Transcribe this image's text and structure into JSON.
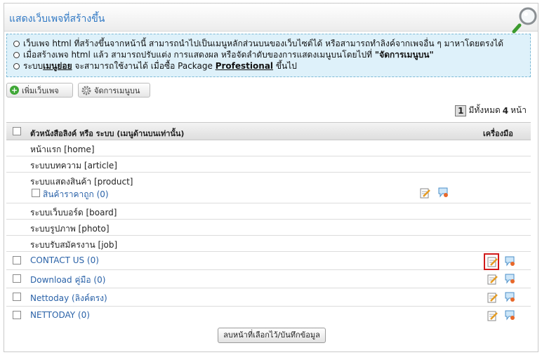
{
  "header": {
    "title": "แสดงเว็บเพจที่สร้างขึ้น"
  },
  "notice": {
    "line1": "เว็บเพจ html ที่สร้างขึ้นจากหน้านี้ สามารถนำไปเป็นเมนูหลักส่วนบนของเว็บไซต์ได้ หรือสามารถทำลิงค์จากเพจอื่น ๆ มาหาโดยตรงได้",
    "line2_a": "เมื่อสร้างเพจ html แล้ว สามารถปรับแต่ง การแสดงผล หรือจัดลำดับของการแสดงเมนูบนโดยไปที่ ",
    "line2_b": "\"จัดการเมนูบน\"",
    "line3_a": "ระบบ",
    "line3_b": "เมนูย่อย",
    "line3_c": " จะสามารถใช้งานได้ เมื่อซื้อ Package ",
    "line3_d": "Profestional",
    "line3_e": " ขึ้นไป"
  },
  "toolbar": {
    "add_label": "เพิ่มเว็บเพจ",
    "menu_label": "จัดการเมนูบน"
  },
  "pager": {
    "page": "1",
    "text_a": "มีทั้งหมด",
    "total": "4",
    "text_b": "หน้า"
  },
  "table": {
    "header_name": "ตัวหนังสือลิงค์ หรือ ระบบ (เมนูด้านบนเท่านั้น)",
    "header_tools": "เครื่องมือ",
    "rows": [
      {
        "label": "หน้าแรก [home]"
      },
      {
        "label": "ระบบบทความ [article]"
      },
      {
        "label": "ระบบแสดงสินค้า [product]",
        "sub": "สินค้าราคาถูก (0)"
      },
      {
        "label": "ระบบเว็บบอร์ด [board]"
      },
      {
        "label": "ระบบรูปภาพ [photo]"
      },
      {
        "label": "ระบบรับสมัครงาน [job]"
      },
      {
        "label": "CONTACT US (0)"
      },
      {
        "label": "Download คู่มือ (0)"
      },
      {
        "label": "Nettoday (ลิงค์ตรง)"
      },
      {
        "label": "NETTODAY (0)"
      }
    ]
  },
  "footer": {
    "save_label": "ลบหน้าที่เลือกไว้/บันทึกข้อมูล"
  },
  "colors": {
    "accent": "#2f78c4",
    "link": "#2a62a8",
    "highlight": "#d11a1a",
    "notice_bg": "#def1fa"
  },
  "icons": [
    "magnifier-icon",
    "plus-icon",
    "gear-icon",
    "edit-icon",
    "comment-icon"
  ]
}
